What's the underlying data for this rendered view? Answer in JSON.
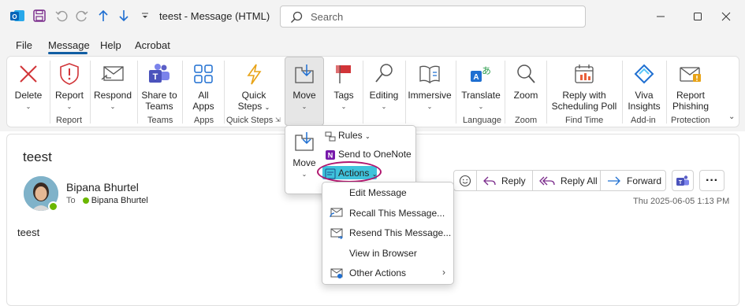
{
  "window": {
    "title": "teest  -  Message (HTML)",
    "search_placeholder": "Search"
  },
  "menubar": {
    "tabs": [
      "File",
      "Message",
      "Help",
      "Acrobat"
    ],
    "active_tab": "Message"
  },
  "ribbon": {
    "delete": "Delete",
    "report": "Report",
    "respond": "Respond",
    "share_teams_1": "Share to",
    "share_teams_2": "Teams",
    "all_apps_1": "All",
    "all_apps_2": "Apps",
    "quick_steps_1": "Quick",
    "quick_steps_2": "Steps",
    "move": "Move",
    "tags": "Tags",
    "editing": "Editing",
    "immersive": "Immersive",
    "translate": "Translate",
    "zoom": "Zoom",
    "reply_sched_1": "Reply with",
    "reply_sched_2": "Scheduling Poll",
    "viva_1": "Viva",
    "viva_2": "Insights",
    "report_phishing_1": "Report",
    "report_phishing_2": "Phishing",
    "groups": {
      "report": "Report",
      "teams": "Teams",
      "apps": "Apps",
      "quick_steps": "Quick Steps",
      "language": "Language",
      "zoom": "Zoom",
      "find_time": "Find Time",
      "addin": "Add-in",
      "protection": "Protection"
    }
  },
  "move_popup": {
    "move": "Move",
    "rules": "Rules",
    "send_onenote": "Send to OneNote",
    "actions": "Actions"
  },
  "actions_menu": {
    "items": [
      "Edit Message",
      "Recall This Message...",
      "Resend This Message...",
      "View in Browser",
      "Other Actions"
    ]
  },
  "message": {
    "subject": "teest",
    "sender": "Bipana Bhurtel",
    "to_label": "To",
    "recipient": "Bipana Bhurtel",
    "date": "Thu 2025-06-05 1:13 PM",
    "body": "teest"
  },
  "message_actions": {
    "reply": "Reply",
    "reply_all": "Reply All",
    "forward": "Forward"
  },
  "colors": {
    "accent": "#115ea3",
    "actions_highlight": "#3fc3dc",
    "annotation_ring": "#b0176f",
    "presence": "#6bb700"
  }
}
